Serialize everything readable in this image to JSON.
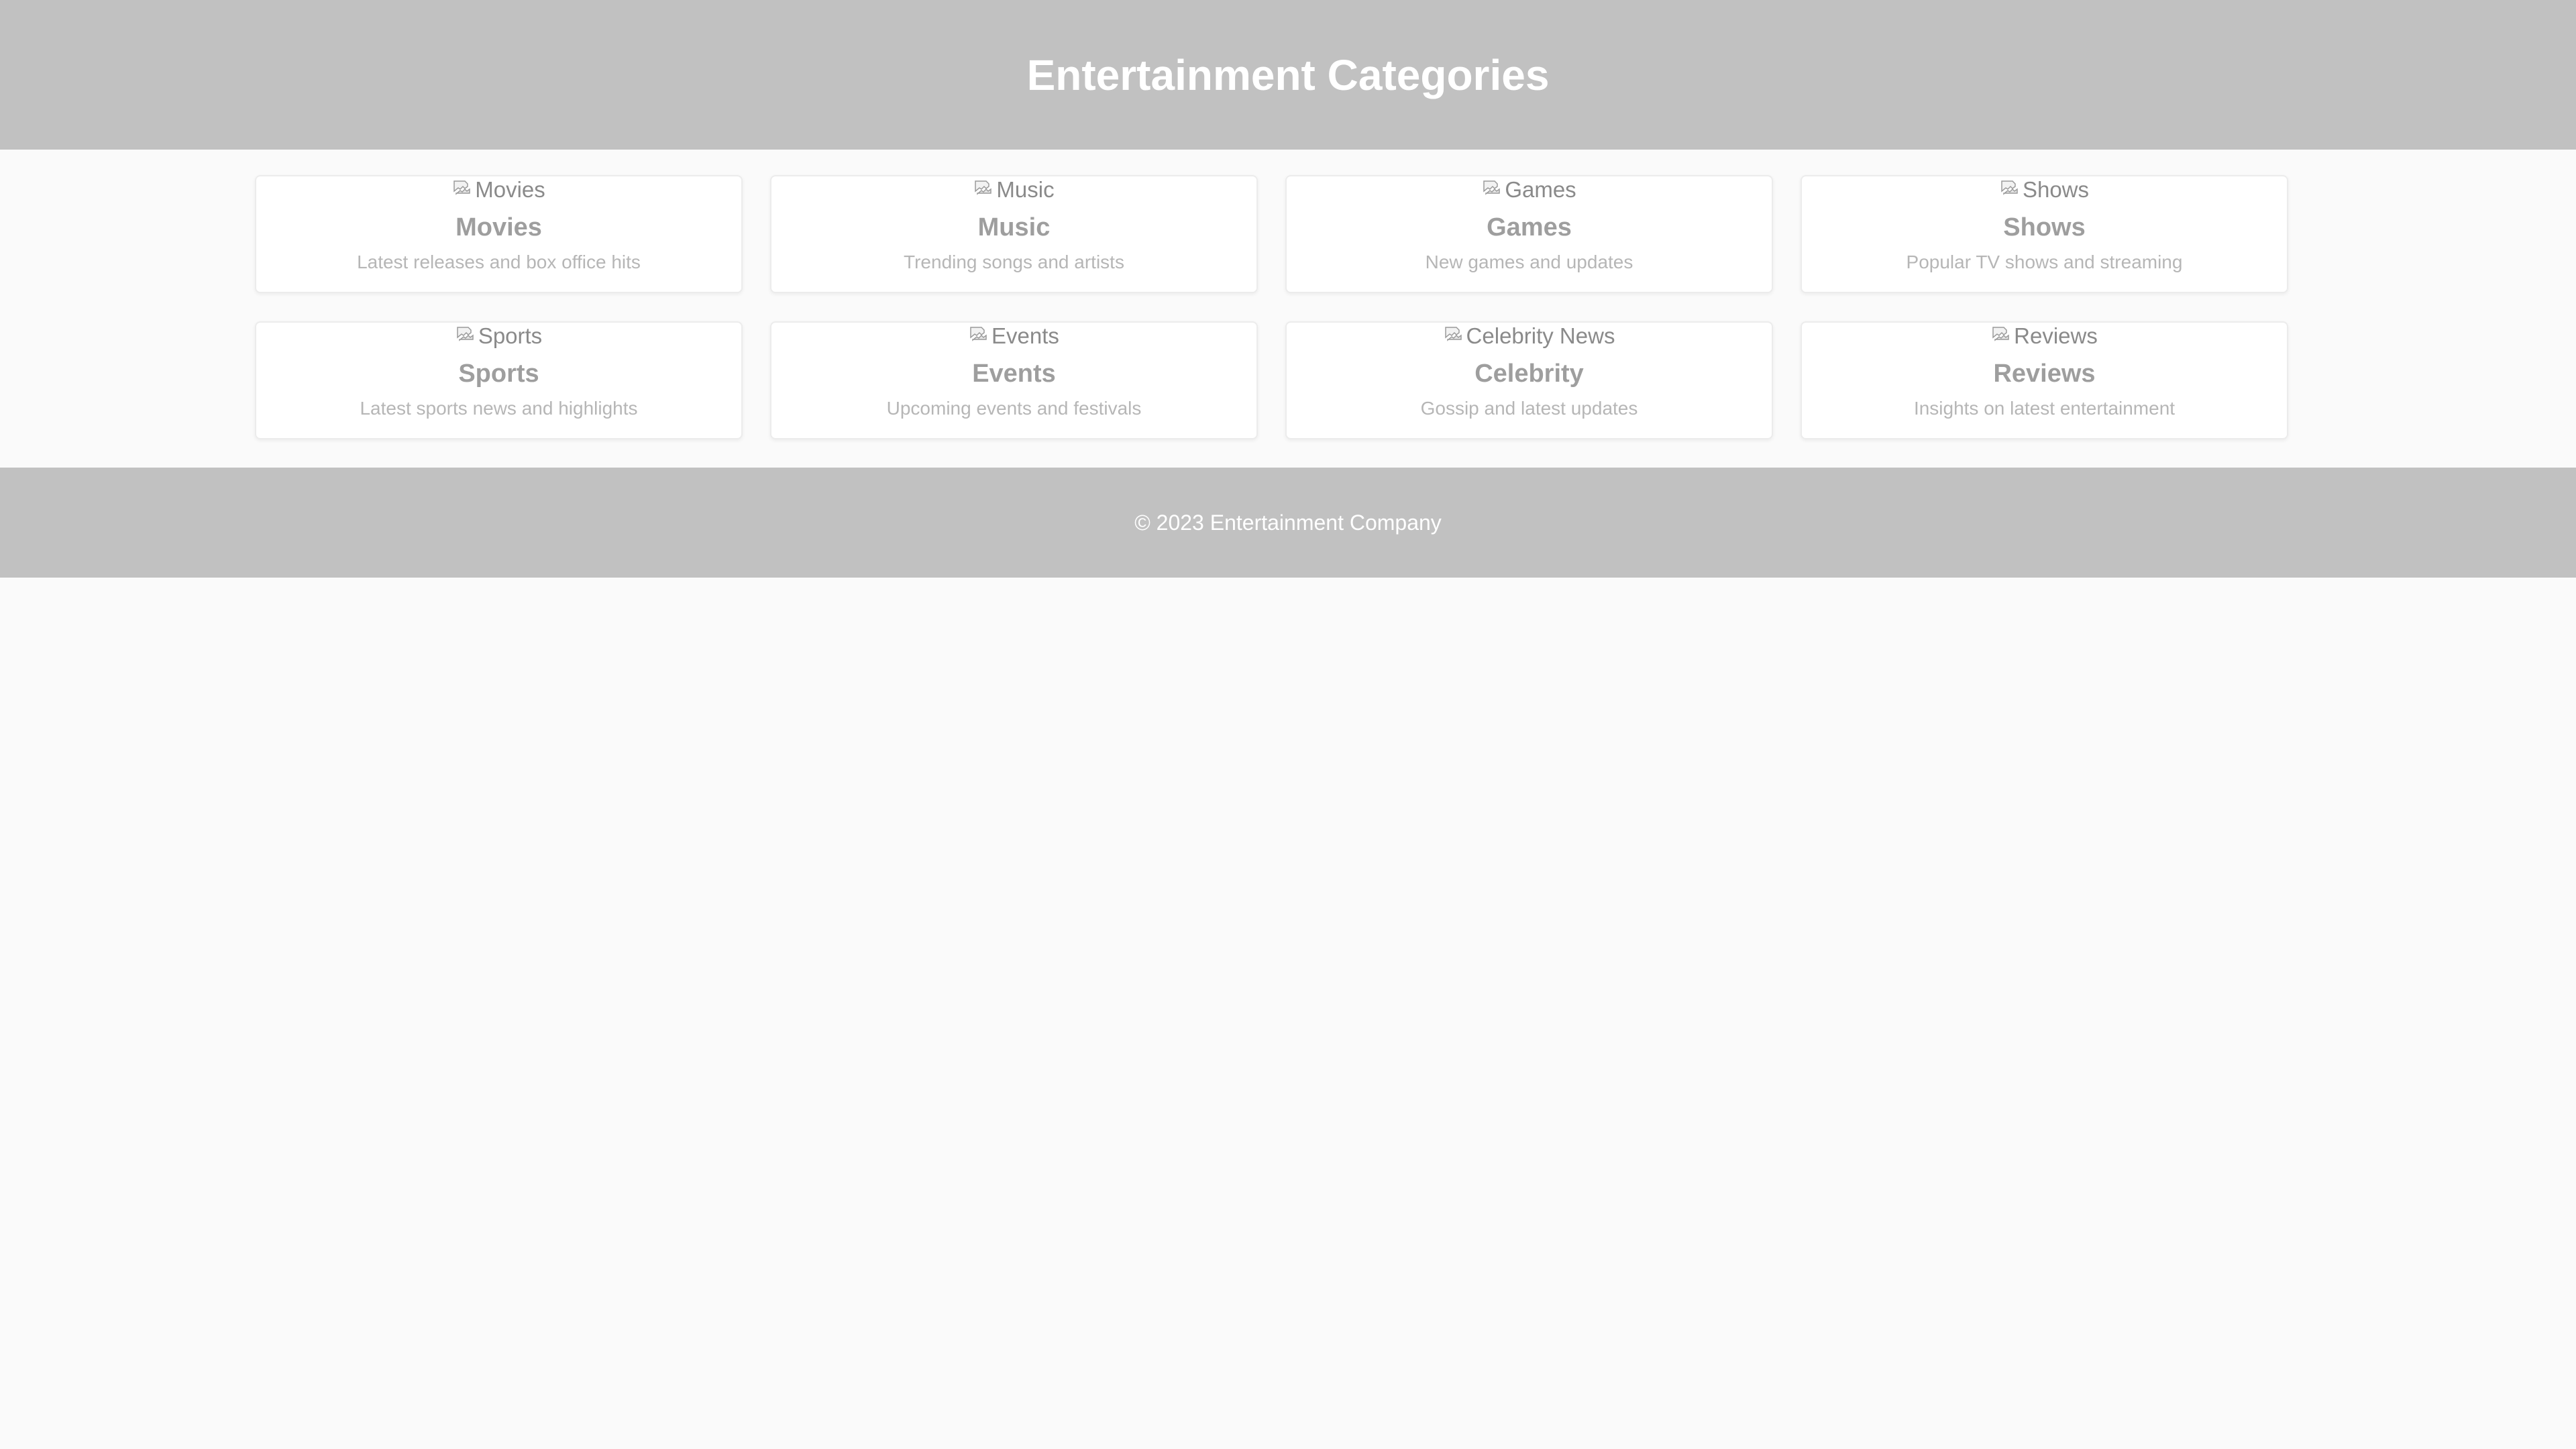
{
  "header": {
    "title": "Entertainment Categories"
  },
  "categories": [
    {
      "image_alt": "Movies",
      "icon": "broken-image-icon",
      "title": "Movies",
      "description": "Latest releases and box office hits"
    },
    {
      "image_alt": "Music",
      "icon": "broken-image-icon",
      "title": "Music",
      "description": "Trending songs and artists"
    },
    {
      "image_alt": "Games",
      "icon": "broken-image-icon",
      "title": "Games",
      "description": "New games and updates"
    },
    {
      "image_alt": "Shows",
      "icon": "broken-image-icon",
      "title": "Shows",
      "description": "Popular TV shows and streaming"
    },
    {
      "image_alt": "Sports",
      "icon": "broken-image-icon",
      "title": "Sports",
      "description": "Latest sports news and highlights"
    },
    {
      "image_alt": "Events",
      "icon": "broken-image-icon",
      "title": "Events",
      "description": "Upcoming events and festivals"
    },
    {
      "image_alt": "Celebrity News",
      "icon": "broken-image-icon",
      "title": "Celebrity",
      "description": "Gossip and latest updates"
    },
    {
      "image_alt": "Reviews",
      "icon": "broken-image-icon",
      "title": "Reviews",
      "description": "Insights on latest entertainment"
    }
  ],
  "footer": {
    "text": "© 2023 Entertainment Company"
  },
  "colors": {
    "header_bg": "#c1c1c1",
    "footer_bg": "#c1c1c1",
    "page_bg": "#fafafa",
    "card_bg": "#ffffff"
  }
}
